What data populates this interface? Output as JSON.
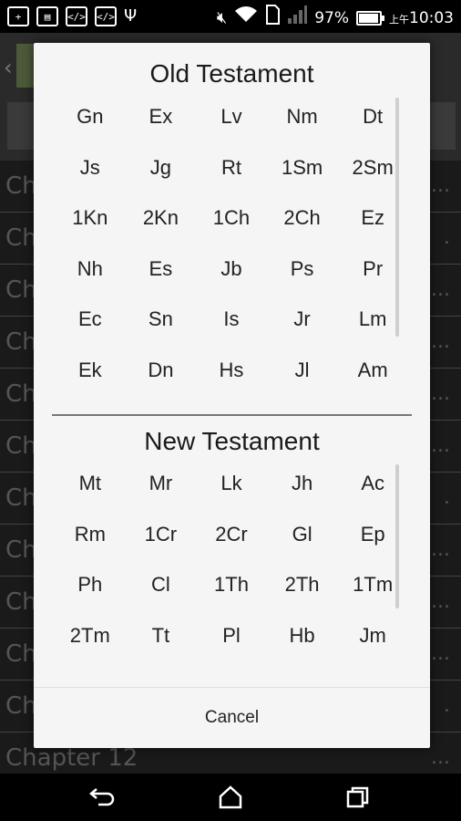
{
  "status_bar": {
    "left_icons": [
      "add-icon",
      "image-icon",
      "code-icon",
      "code-icon",
      "usb-icon"
    ],
    "battery_percent": "97%",
    "battery_level": 0.97,
    "time_prefix": "上午",
    "time": "10:03"
  },
  "background": {
    "chapter_rows": [
      {
        "label": "Ch",
        "tail": "..."
      },
      {
        "label": "Ch",
        "tail": "."
      },
      {
        "label": "Ch",
        "tail": "..."
      },
      {
        "label": "Ch",
        "tail": "..."
      },
      {
        "label": "Ch",
        "tail": "..."
      },
      {
        "label": "Ch",
        "tail": "..."
      },
      {
        "label": "Ch",
        "tail": "."
      },
      {
        "label": "Ch",
        "tail": "..."
      },
      {
        "label": "Ch",
        "tail": "..."
      },
      {
        "label": "Ch",
        "tail": "..."
      },
      {
        "label": "Ch",
        "tail": "."
      },
      {
        "label": "Chapter 12",
        "tail": "..."
      }
    ]
  },
  "dialog": {
    "old_testament_title": "Old Testament",
    "old_testament_books": [
      "Gn",
      "Ex",
      "Lv",
      "Nm",
      "Dt",
      "Js",
      "Jg",
      "Rt",
      "1Sm",
      "2Sm",
      "1Kn",
      "2Kn",
      "1Ch",
      "2Ch",
      "Ez",
      "Nh",
      "Es",
      "Jb",
      "Ps",
      "Pr",
      "Ec",
      "Sn",
      "Is",
      "Jr",
      "Lm",
      "Ek",
      "Dn",
      "Hs",
      "Jl",
      "Am"
    ],
    "new_testament_title": "New Testament",
    "new_testament_books": [
      "Mt",
      "Mr",
      "Lk",
      "Jh",
      "Ac",
      "Rm",
      "1Cr",
      "2Cr",
      "Gl",
      "Ep",
      "Ph",
      "Cl",
      "1Th",
      "2Th",
      "1Tm",
      "2Tm",
      "Tt",
      "Pl",
      "Hb",
      "Jm"
    ],
    "cancel_label": "Cancel"
  },
  "navigation": [
    "back-icon",
    "home-icon",
    "recents-icon"
  ]
}
